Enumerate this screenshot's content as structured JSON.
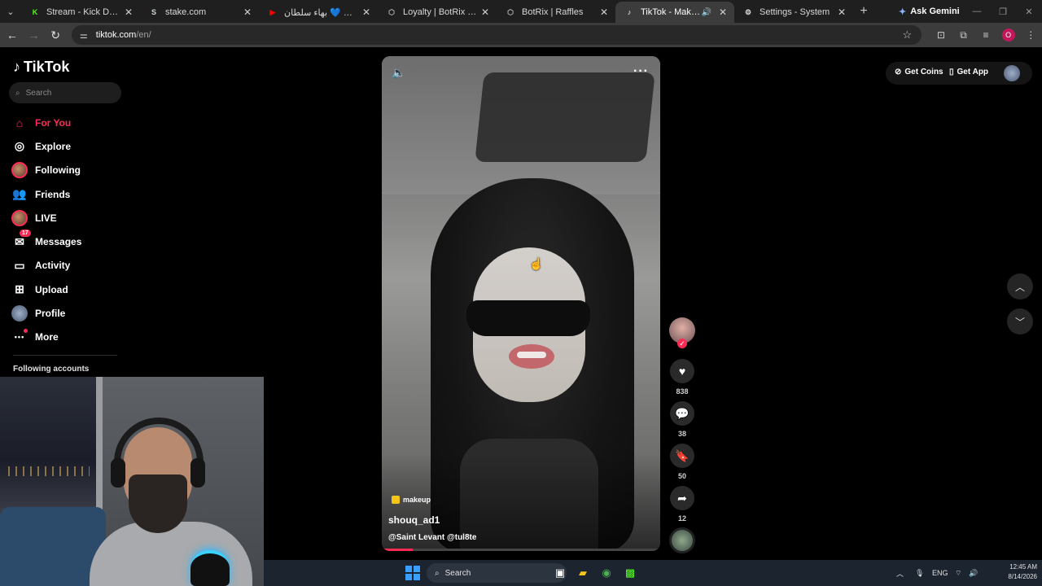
{
  "browser": {
    "tabs": [
      {
        "label": "Stream - Kick Dashboard",
        "favicon": "kick-icon",
        "fav_glyph": "K",
        "fav_color": "#53fc18"
      },
      {
        "label": "stake.com",
        "favicon": "stake-icon",
        "fav_glyph": "S",
        "fav_color": "#cfd8dc"
      },
      {
        "label": "بهاء سلطان 💙 ‎🎚 ‎تكلم نفسي",
        "favicon": "youtube-icon",
        "fav_glyph": "▶",
        "fav_color": "#ff0000"
      },
      {
        "label": "Loyalty | BotRix — Cloud St",
        "favicon": "botrix-icon",
        "fav_glyph": "⬡",
        "fav_color": "#bbbbbb"
      },
      {
        "label": "BotRix | Raffles",
        "favicon": "botrix-icon",
        "fav_glyph": "⬡",
        "fav_color": "#bbbbbb"
      },
      {
        "label": "TikTok - Make Your Day",
        "favicon": "tiktok-icon",
        "fav_glyph": "♪",
        "fav_color": "#ffffff",
        "active": true,
        "audio": true
      },
      {
        "label": "Settings - System",
        "favicon": "gear-icon",
        "fav_glyph": "⚙",
        "fav_color": "#dddddd"
      }
    ],
    "ask_gemini": "Ask Gemini",
    "url_host": "tiktok.com",
    "url_path": "/en/",
    "profile_initial": "O"
  },
  "tiktok": {
    "logo": "TikTok",
    "search_placeholder": "Search",
    "nav": [
      {
        "label": "For You",
        "icon": "home-icon",
        "glyph": "⌂",
        "active": true
      },
      {
        "label": "Explore",
        "icon": "compass-icon",
        "glyph": "◎"
      },
      {
        "label": "Following",
        "icon": "following-avatar",
        "glyph": ""
      },
      {
        "label": "Friends",
        "icon": "friends-icon",
        "glyph": "👥"
      },
      {
        "label": "LIVE",
        "icon": "live-avatar",
        "glyph": ""
      },
      {
        "label": "Messages",
        "icon": "messages-icon",
        "glyph": "✉",
        "badge": "17"
      },
      {
        "label": "Activity",
        "icon": "activity-icon",
        "glyph": "▭"
      },
      {
        "label": "Upload",
        "icon": "upload-icon",
        "glyph": "⊞"
      },
      {
        "label": "Profile",
        "icon": "profile-avatar",
        "glyph": ""
      },
      {
        "label": "More",
        "icon": "more-icon",
        "glyph": "•••",
        "dot": true
      }
    ],
    "following_accounts_heading": "Following accounts",
    "get_coins": "Get Coins",
    "get_app": "Get App"
  },
  "video": {
    "tag": "makeup",
    "username": "shouq_ad1",
    "description": "@Saint Levant @tul8te",
    "progress": 0.11
  },
  "actions": {
    "likes": "838",
    "comments": "38",
    "saves": "50",
    "shares": "12"
  },
  "taskbar": {
    "search_placeholder": "Search",
    "language": "ENG",
    "time": "12:45 AM",
    "date": "8/14/2026"
  }
}
